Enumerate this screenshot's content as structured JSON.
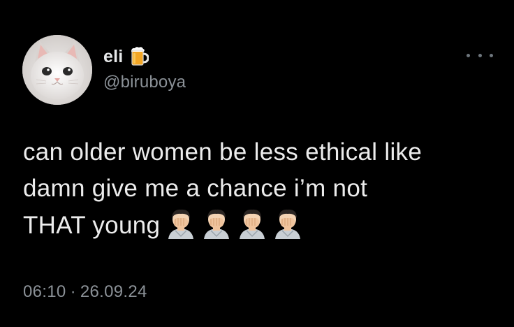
{
  "author": {
    "display_name": "eli",
    "handle": "@biruboya",
    "avatar_icon": "cat-avatar",
    "badge_icon": "beer-mug-icon"
  },
  "menu": {
    "more_icon": "more-options-icon"
  },
  "tweet": {
    "lines": [
      "can older women be less ethical like",
      "damn give me a chance i’m not",
      "THAT young"
    ],
    "emojis": [
      "facepalm-icon",
      "facepalm-icon",
      "facepalm-icon",
      "facepalm-icon"
    ]
  },
  "meta": {
    "time": "06:10",
    "separator": "·",
    "date": "26.09.24"
  },
  "colors": {
    "background": "#000000",
    "text": "#e7e9ea",
    "secondary": "#8b9197"
  }
}
